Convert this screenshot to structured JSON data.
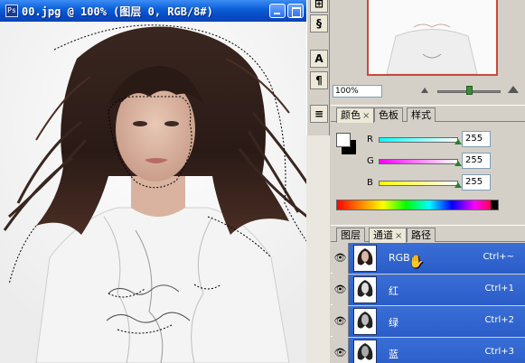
{
  "document": {
    "title": "00.jpg @ 100% (图层 0, RGB/8#)",
    "icon_label": "Ps"
  },
  "tools": {
    "items": [
      {
        "name": "tool-preset",
        "glyph": "⊞"
      },
      {
        "name": "clone-stamp",
        "glyph": "§"
      },
      {
        "name": "character",
        "glyph": "A"
      },
      {
        "name": "paragraph",
        "glyph": "¶"
      },
      {
        "name": "layer-comps",
        "glyph": "≡"
      }
    ]
  },
  "navigator": {
    "zoom_value": "100%",
    "zoom_level_percent": 100
  },
  "color_panel": {
    "tabs": [
      {
        "label": "颜色",
        "active": true,
        "closable": true
      },
      {
        "label": "色板",
        "active": false,
        "closable": false
      },
      {
        "label": "样式",
        "active": false,
        "closable": false
      }
    ],
    "foreground_color": "#ffffff",
    "background_color": "#000000",
    "channels": [
      {
        "label": "R",
        "value": "255",
        "gradient_start": "#00ffff",
        "gradient_end": "#ffffff"
      },
      {
        "label": "G",
        "value": "255",
        "gradient_start": "#ff00ff",
        "gradient_end": "#ffffff"
      },
      {
        "label": "B",
        "value": "255",
        "gradient_start": "#ffff00",
        "gradient_end": "#ffffff"
      }
    ]
  },
  "channels_panel": {
    "tabs": [
      {
        "label": "图层",
        "active": false,
        "closable": false
      },
      {
        "label": "通道",
        "active": true,
        "closable": true
      },
      {
        "label": "路径",
        "active": false,
        "closable": false
      }
    ],
    "rows": [
      {
        "name": "RGB",
        "shortcut": "Ctrl+~",
        "visible": true,
        "selected": true
      },
      {
        "name": "红",
        "shortcut": "Ctrl+1",
        "visible": true,
        "selected": true
      },
      {
        "name": "绿",
        "shortcut": "Ctrl+2",
        "visible": true,
        "selected": true
      },
      {
        "name": "蓝",
        "shortcut": "Ctrl+3",
        "visible": true,
        "selected": true
      }
    ]
  },
  "colors": {
    "title_bar": "#0a5fd8",
    "selected_row": "#2a5cc8",
    "panel_bg": "#d4d0c8",
    "navigator_frame": "#c84a3c"
  }
}
